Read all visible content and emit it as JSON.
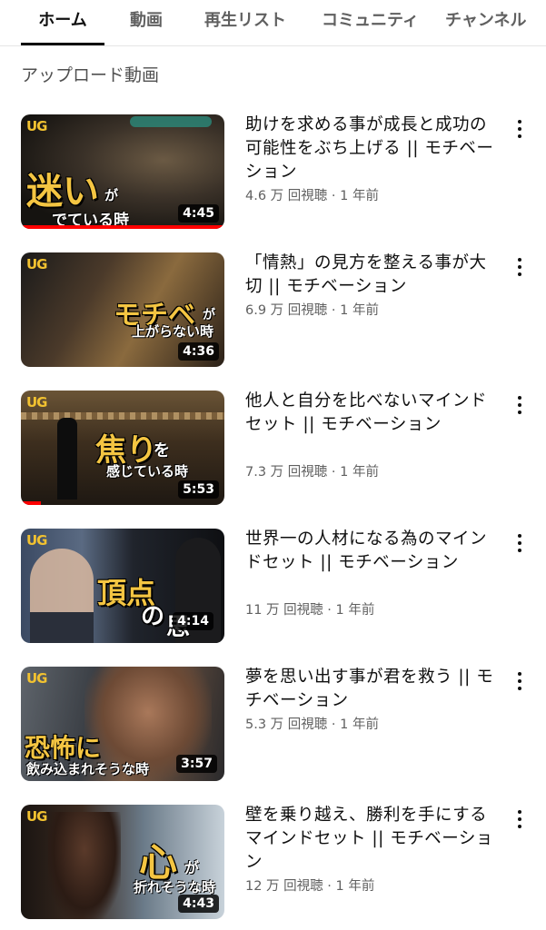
{
  "tabs": [
    {
      "label": "ホーム",
      "active": true
    },
    {
      "label": "動画",
      "active": false
    },
    {
      "label": "再生リスト",
      "active": false
    },
    {
      "label": "コミュニティ",
      "active": false
    },
    {
      "label": "チャンネル",
      "active": false
    }
  ],
  "section_title": "アップロード動画",
  "channel_logo": "UG",
  "videos": [
    {
      "title": "助けを求める事が成長と成功の可能性をぶち上げる || モチベーション",
      "meta": "4.6 万 回視聴 · 1 年前",
      "duration": "4:45",
      "thumb_big": "迷い",
      "thumb_big_suffix": "が",
      "thumb_small": "でている時",
      "watch_progress": 1.0
    },
    {
      "title": "「情熱」の見方を整える事が大切 || モチベーション",
      "meta": "6.9 万 回視聴 · 1 年前",
      "duration": "4:36",
      "thumb_big": "モチベ",
      "thumb_big_suffix": "が",
      "thumb_small": "上がらない時"
    },
    {
      "title": "他人と自分を比べないマインドセット || モチベーション",
      "meta": "7.3 万 回視聴 · 1 年前",
      "duration": "5:53",
      "thumb_big": "焦り",
      "thumb_big_suffix": "を",
      "thumb_small": "感じている時",
      "watch_progress": 0.1
    },
    {
      "title": "世界一の人材になる為のマインドセット || モチベーション",
      "meta": "11 万 回視聴 · 1 年前",
      "duration": "4:14",
      "thumb_big": "頂点",
      "thumb_big_suffix": "の",
      "thumb_small": "思"
    },
    {
      "title": "夢を思い出す事が君を救う || モチベーション",
      "meta": "5.3 万 回視聴 · 1 年前",
      "duration": "3:57",
      "thumb_big": "恐怖に",
      "thumb_big_suffix": "",
      "thumb_small": "飲み込まれそうな時"
    },
    {
      "title": "壁を乗り越え、勝利を手にするマインドセット || モチベーション",
      "meta": "12 万 回視聴 · 1 年前",
      "duration": "4:43",
      "thumb_big": "心",
      "thumb_big_suffix": "が",
      "thumb_small": "折れそうな時"
    }
  ]
}
